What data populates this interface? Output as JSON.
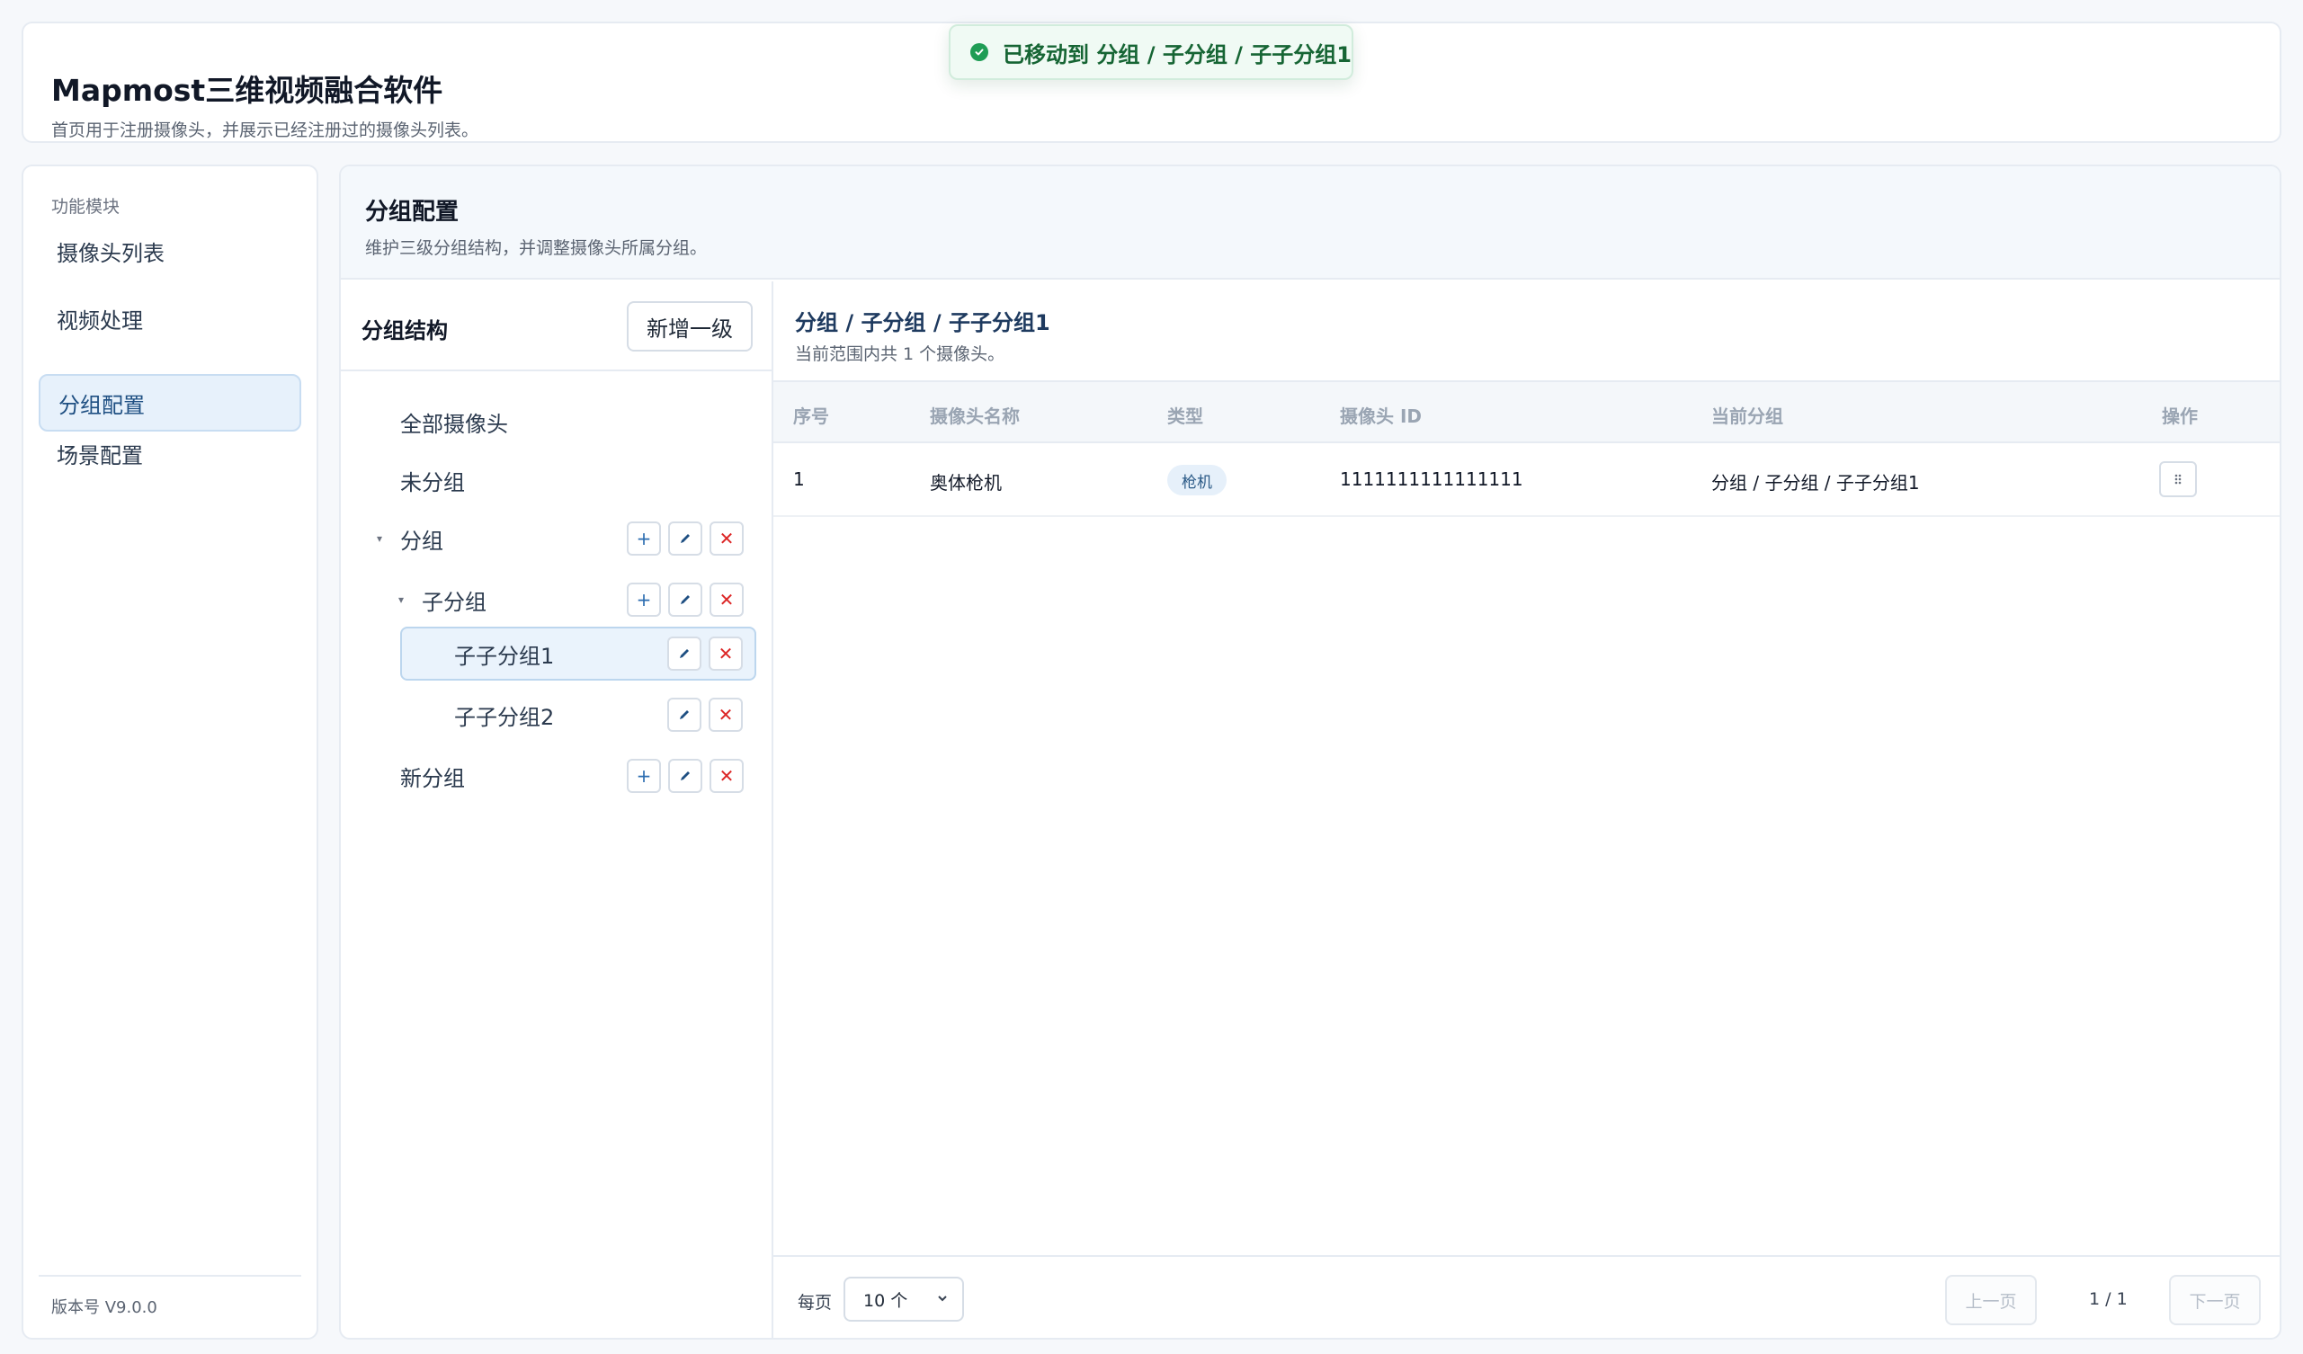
{
  "header": {
    "title": "Mapmost三维视频融合软件",
    "subtitle": "首页用于注册摄像头，并展示已经注册过的摄像头列表。"
  },
  "toast": {
    "message": "已移动到 分组 / 子分组 / 子子分组1",
    "color": "#1f9d55"
  },
  "sidebar": {
    "section_label": "功能模块",
    "items": [
      {
        "label": "摄像头列表"
      },
      {
        "label": "视频处理"
      },
      {
        "label": "分组配置"
      },
      {
        "label": "场景配置"
      }
    ],
    "active_index": 2,
    "version": "版本号 V9.0.0"
  },
  "main": {
    "title": "分组配置",
    "subtitle": "维护三级分组结构，并调整摄像头所属分组。"
  },
  "tree": {
    "title": "分组结构",
    "add_root_label": "新增一级",
    "nodes": [
      {
        "label": "全部摄像头"
      },
      {
        "label": "未分组"
      },
      {
        "label": "分组"
      },
      {
        "label": "子分组"
      },
      {
        "label": "子子分组1"
      },
      {
        "label": "子子分组2"
      },
      {
        "label": "新分组"
      }
    ],
    "selected": "子子分组1"
  },
  "detail": {
    "path": "分组 / 子分组 / 子子分组1",
    "count_text": "当前范围内共 1 个摄像头。",
    "columns": [
      "序号",
      "摄像头名称",
      "类型",
      "摄像头 ID",
      "当前分组",
      "操作"
    ],
    "rows": [
      {
        "index": "1",
        "name": "奥体枪机",
        "type": "枪机",
        "id": "1111111111111111",
        "group": "分组 / 子分组 / 子子分组1"
      }
    ]
  },
  "pagination": {
    "per_page_label": "每页",
    "per_page_value": "10 个",
    "prev_label": "上一页",
    "next_label": "下一页",
    "page_info": "1 / 1"
  },
  "colors": {
    "accent": "#1e4f82",
    "delete": "#dc2626",
    "success": "#1f9d55"
  }
}
